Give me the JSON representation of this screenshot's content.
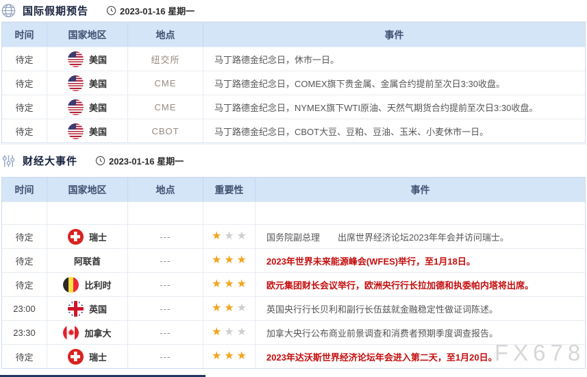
{
  "page": {
    "watermark": "FX678"
  },
  "colors": {
    "header_bg": "#d5e5f8",
    "star_gold": "#f2a51e",
    "star_gray": "#cfcfcf",
    "event_red": "#c40d0d",
    "navy_bar": "#23365f"
  },
  "holiday_section": {
    "icon": "globe-icon",
    "title": "国际假期预告",
    "date": "2023-01-16 星期一",
    "headers": {
      "time": "时间",
      "country": "国家地区",
      "location": "地点",
      "event": "事件"
    },
    "rows": [
      {
        "time": "待定",
        "flag": "us",
        "country": "美国",
        "location": "纽交所",
        "event": "马丁路德金纪念日，休市一日。"
      },
      {
        "time": "待定",
        "flag": "us",
        "country": "美国",
        "location": "CME",
        "event": "马丁路德金纪念日，COMEX旗下贵金属、金属合约提前至次日3:30收盘。"
      },
      {
        "time": "待定",
        "flag": "us",
        "country": "美国",
        "location": "CME",
        "event": "马丁路德金纪念日，NYMEX旗下WTI原油、天然气期货合约提前至次日3:30收盘。"
      },
      {
        "time": "待定",
        "flag": "us",
        "country": "美国",
        "location": "CBOT",
        "event": "马丁路德金纪念日，CBOT大豆、豆粕、豆油、玉米、小麦休市一日。"
      }
    ]
  },
  "events_section": {
    "icon": "sliders-icon",
    "title": "财经大事件",
    "date": "2023-01-16 星期一",
    "headers": {
      "time": "时间",
      "country": "国家地区",
      "location": "地点",
      "importance": "重要性",
      "event": "事件"
    },
    "faded_row": {
      "time": "",
      "country": "",
      "location": "",
      "event": ""
    },
    "rows": [
      {
        "time": "待定",
        "flag": "ch",
        "country": "瑞士",
        "location": "---",
        "stars": 1,
        "red": false,
        "event": "国务院副总理　　出席世界经济论坛2023年年会并访问瑞士。"
      },
      {
        "time": "待定",
        "flag": "none",
        "country": "阿联酋",
        "location": "---",
        "stars": 3,
        "red": true,
        "event": "2023年世界未来能源峰会(WFES)举行，至1月18日。"
      },
      {
        "time": "待定",
        "flag": "be",
        "country": "比利时",
        "location": "---",
        "stars": 3,
        "red": true,
        "event": "欧元集团财长会议举行，欧洲央行行长拉加德和执委帕内塔将出席。"
      },
      {
        "time": "23:00",
        "flag": "gb",
        "country": "英国",
        "location": "---",
        "stars": 2,
        "red": false,
        "event": "英国央行行长贝利和副行长伍兹就金融稳定性做证词陈述。"
      },
      {
        "time": "23:30",
        "flag": "ca",
        "country": "加拿大",
        "location": "---",
        "stars": 1,
        "red": false,
        "event": "加拿大央行公布商业前景调查和消费者预期季度调查报告。"
      },
      {
        "time": "待定",
        "flag": "ch",
        "country": "瑞士",
        "location": "---",
        "stars": 3,
        "red": true,
        "event": "2023年达沃斯世界经济论坛年会进入第二天，至1月20日。"
      }
    ]
  }
}
